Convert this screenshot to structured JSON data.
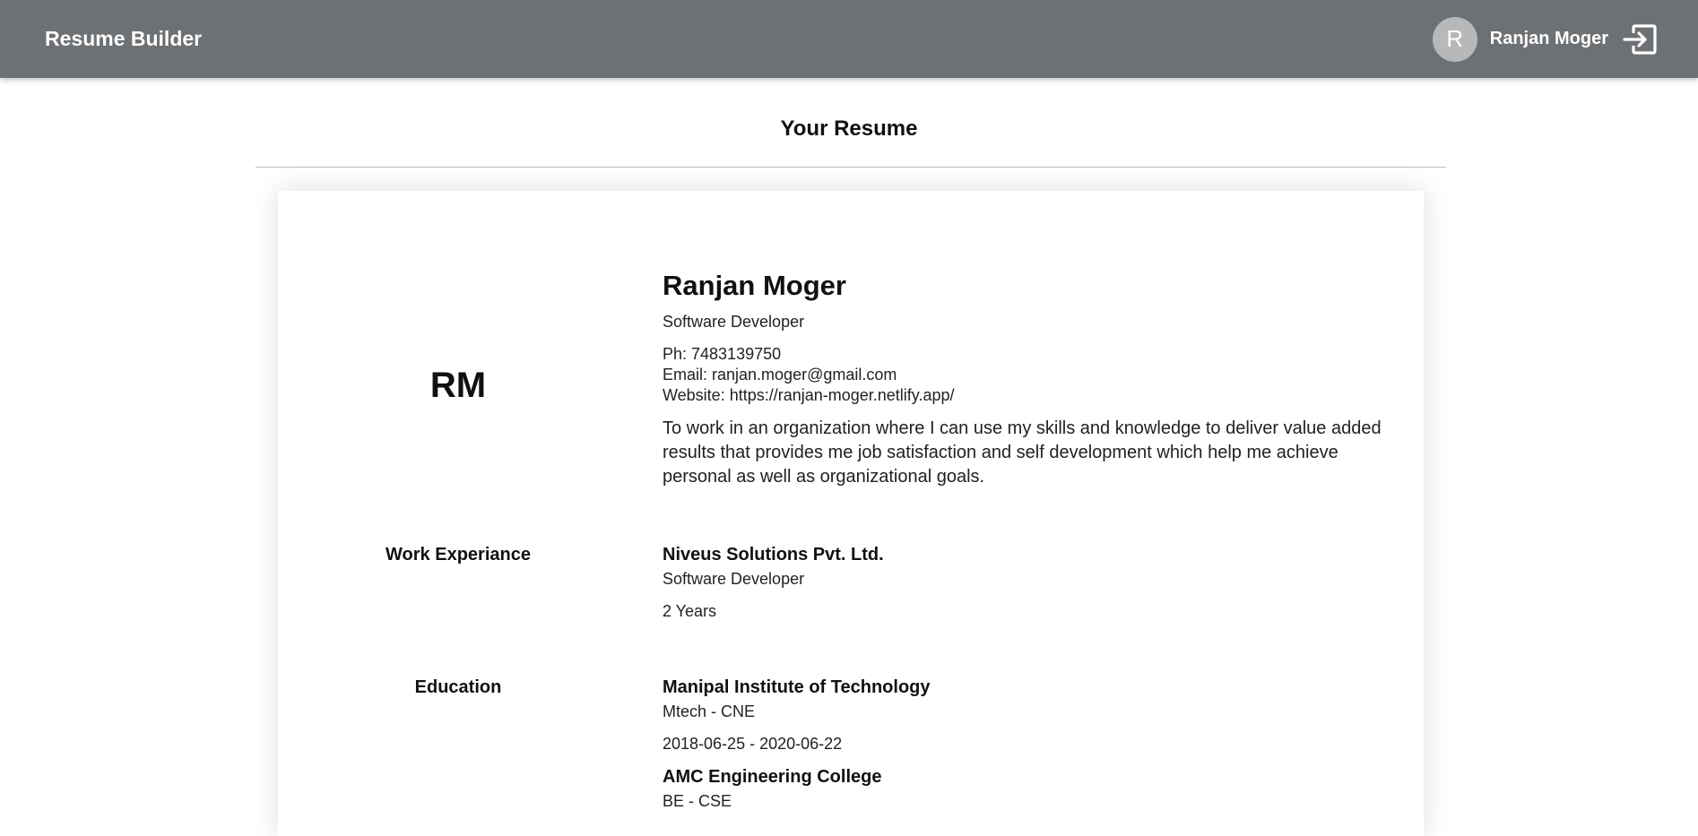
{
  "header": {
    "brand": "Resume Builder",
    "avatar_letter": "R",
    "user_name": "Ranjan Moger",
    "logout_icon": "logout-icon"
  },
  "page": {
    "heading": "Your Resume"
  },
  "resume": {
    "initials": "RM",
    "name": "Ranjan Moger",
    "role": "Software Developer",
    "phone": "Ph: 7483139750",
    "email": "Email: ranjan.moger@gmail.com",
    "website": "Website: https://ranjan-moger.netlify.app/",
    "objective": "To work in an organization where I can use my skills and knowledge to deliver value added results that provides me job satisfaction and self development which help me achieve personal as well as organizational goals.",
    "work": {
      "label": "Work Experiance",
      "entries": [
        {
          "company": "Niveus Solutions Pvt. Ltd.",
          "position": "Software Developer",
          "duration": "2 Years"
        }
      ]
    },
    "education": {
      "label": "Education",
      "entries": [
        {
          "institution": "Manipal Institute of Technology",
          "degree": "Mtech - CNE",
          "dates": "2018-06-25 - 2020-06-22"
        },
        {
          "institution": "AMC Engineering College",
          "degree": "BE - CSE"
        }
      ]
    }
  }
}
